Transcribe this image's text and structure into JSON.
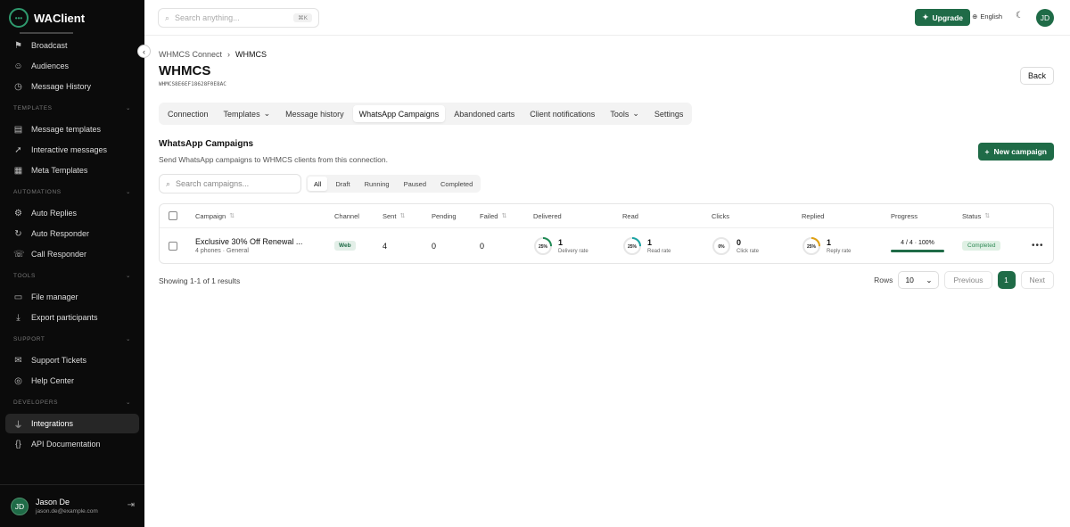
{
  "app": {
    "name": "WAClient"
  },
  "search": {
    "placeholder": "Search anything...",
    "shortcut": "⌘K"
  },
  "topbar": {
    "upgrade_label": "Upgrade",
    "language": "English",
    "avatar_initials": "JD"
  },
  "sidebar": {
    "items_top": [
      {
        "label": "Broadcast",
        "icon": "megaphone-icon",
        "glyph": "⚑"
      },
      {
        "label": "Audiences",
        "icon": "users-icon",
        "glyph": "☺"
      },
      {
        "label": "Message History",
        "icon": "history-icon",
        "glyph": "◷"
      }
    ],
    "sections": [
      {
        "title": "TEMPLATES",
        "items": [
          {
            "label": "Message templates",
            "glyph": "▤"
          },
          {
            "label": "Interactive messages",
            "glyph": "➚"
          },
          {
            "label": "Meta Templates",
            "glyph": "▦"
          }
        ]
      },
      {
        "title": "AUTOMATIONS",
        "items": [
          {
            "label": "Auto Replies",
            "glyph": "⚙"
          },
          {
            "label": "Auto Responder",
            "glyph": "↻"
          },
          {
            "label": "Call Responder",
            "glyph": "☏"
          }
        ]
      },
      {
        "title": "TOOLS",
        "items": [
          {
            "label": "File manager",
            "glyph": "▭"
          },
          {
            "label": "Export participants",
            "glyph": "⤓"
          }
        ]
      },
      {
        "title": "SUPPORT",
        "items": [
          {
            "label": "Support Tickets",
            "glyph": "✉"
          },
          {
            "label": "Help Center",
            "glyph": "◎"
          }
        ]
      },
      {
        "title": "DEVELOPERS",
        "items": [
          {
            "label": "Integrations",
            "glyph": "⏚"
          },
          {
            "label": "API Documentation",
            "glyph": "{}"
          }
        ]
      }
    ],
    "active": "Integrations",
    "user": {
      "initials": "JD",
      "name": "Jason De",
      "email": "jason.de@example.com"
    }
  },
  "breadcrumb": {
    "parent": "WHMCS Connect",
    "current": "WHMCS"
  },
  "page": {
    "title": "WHMCS",
    "subtitle": "WHMCS8E6EF18628F0E8AC",
    "back_label": "Back"
  },
  "tabs": [
    {
      "label": "Connection",
      "dropdown": false
    },
    {
      "label": "Templates",
      "dropdown": true
    },
    {
      "label": "Message history",
      "dropdown": false
    },
    {
      "label": "WhatsApp Campaigns",
      "dropdown": false,
      "active": true
    },
    {
      "label": "Abandoned carts",
      "dropdown": false
    },
    {
      "label": "Client notifications",
      "dropdown": false
    },
    {
      "label": "Tools",
      "dropdown": true
    },
    {
      "label": "Settings",
      "dropdown": false
    }
  ],
  "section": {
    "title": "WhatsApp Campaigns",
    "description": "Send WhatsApp campaigns to WHMCS clients from this connection.",
    "new_label": "New campaign"
  },
  "campaign_search": {
    "placeholder": "Search campaigns..."
  },
  "filters": [
    "All",
    "Draft",
    "Running",
    "Paused",
    "Completed"
  ],
  "table": {
    "headers": [
      "Campaign",
      "Channel",
      "Sent",
      "Pending",
      "Failed",
      "Delivered",
      "Read",
      "Clicks",
      "Replied",
      "Progress",
      "Status"
    ],
    "rows": [
      {
        "name": "Exclusive 30% Off Renewal ...",
        "meta": "4 phones · General",
        "channel": "Web",
        "sent": "4",
        "pending": "0",
        "failed": "0",
        "delivered": {
          "pct": 25,
          "pct_label": "25%",
          "value": "1",
          "label": "Delivery rate",
          "color": "#1f8a55"
        },
        "read": {
          "pct": 25,
          "pct_label": "25%",
          "value": "1",
          "label": "Read rate",
          "color": "#1aa3a3"
        },
        "clicks": {
          "pct": 0,
          "pct_label": "0%",
          "value": "0",
          "label": "Click rate",
          "color": "#999999"
        },
        "replied": {
          "pct": 25,
          "pct_label": "25%",
          "value": "1",
          "label": "Reply rate",
          "color": "#e0a010"
        },
        "progress": {
          "text": "4 / 4 · 100%",
          "fraction": 1.0
        },
        "status": "Completed"
      }
    ]
  },
  "footer": {
    "showing": "Showing 1-1 of 1 results",
    "rows_label": "Rows",
    "rows_value": "10",
    "previous": "Previous",
    "page": "1",
    "next": "Next"
  }
}
